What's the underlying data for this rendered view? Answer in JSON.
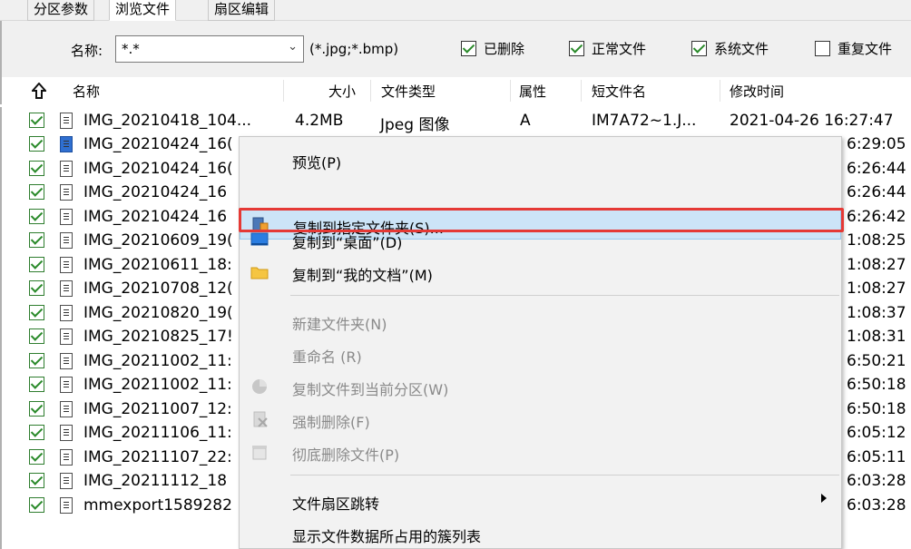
{
  "tabs": [
    {
      "label": "分区参数",
      "active": false
    },
    {
      "label": "浏览文件",
      "active": true
    },
    {
      "label": "扇区编辑",
      "active": false
    }
  ],
  "filter": {
    "name_label": "名称:",
    "name_value": "*.*",
    "name_hint": "(*.jpg;*.bmp)",
    "deleted_label": "已删除",
    "deleted_checked": true,
    "normal_label": "正常文件",
    "normal_checked": true,
    "system_label": "系统文件",
    "system_checked": true,
    "duplicate_label": "重复文件",
    "duplicate_checked": false
  },
  "table": {
    "columns": {
      "name": "名称",
      "size": "大小",
      "type": "文件类型",
      "attr": "属性",
      "short": "短文件名",
      "mtime": "修改时间"
    },
    "first_row": {
      "name": "IMG_20210418_104...",
      "size": "4.2MB",
      "type": "Jpeg 图像",
      "attr": "A",
      "short": "IM7A72~1.J...",
      "mtime": "2021-04-26 16:27:47"
    },
    "rows": [
      {
        "name": "IMG_20210424_16(",
        "time": "6:29:05",
        "selected": true
      },
      {
        "name": "IMG_20210424_16(",
        "time": "6:26:44"
      },
      {
        "name": "IMG_20210424_16",
        "time": "6:26:44"
      },
      {
        "name": "IMG_20210424_16",
        "time": "6:26:42"
      },
      {
        "name": "IMG_20210609_19(",
        "time": "1:08:25"
      },
      {
        "name": "IMG_20210611_18:",
        "time": "1:08:27"
      },
      {
        "name": "IMG_20210708_12(",
        "time": "1:08:27"
      },
      {
        "name": "IMG_20210820_19(",
        "time": "1:08:37"
      },
      {
        "name": "IMG_20210825_17!",
        "time": "1:08:31"
      },
      {
        "name": "IMG_20211002_11:",
        "time": "6:50:21"
      },
      {
        "name": "IMG_20211002_11:",
        "time": "6:50:18"
      },
      {
        "name": "IMG_20211007_12:",
        "time": "6:50:18"
      },
      {
        "name": "IMG_20211106_11:",
        "time": "6:05:12"
      },
      {
        "name": "IMG_20211107_22:",
        "time": "6:05:11"
      },
      {
        "name": "IMG_20211112_18",
        "time": "6:03:28"
      },
      {
        "name": "mmexport1589282",
        "time": "6:03:28"
      }
    ]
  },
  "menu": {
    "preview": "预览(P)",
    "copy_to_folder": "复制到指定文件夹(S)...",
    "copy_to_desktop": "复制到“桌面”(D)",
    "copy_to_docs": "复制到“我的文档”(M)",
    "new_folder": "新建文件夹(N)",
    "rename": "重命名 (R)",
    "copy_to_partition": "复制文件到当前分区(W)",
    "force_delete": "强制删除(F)",
    "wipe_delete": "彻底删除文件(P)",
    "sector_jump": "文件扇区跳转",
    "cluster_list": "显示文件数据所占用的簇列表"
  }
}
